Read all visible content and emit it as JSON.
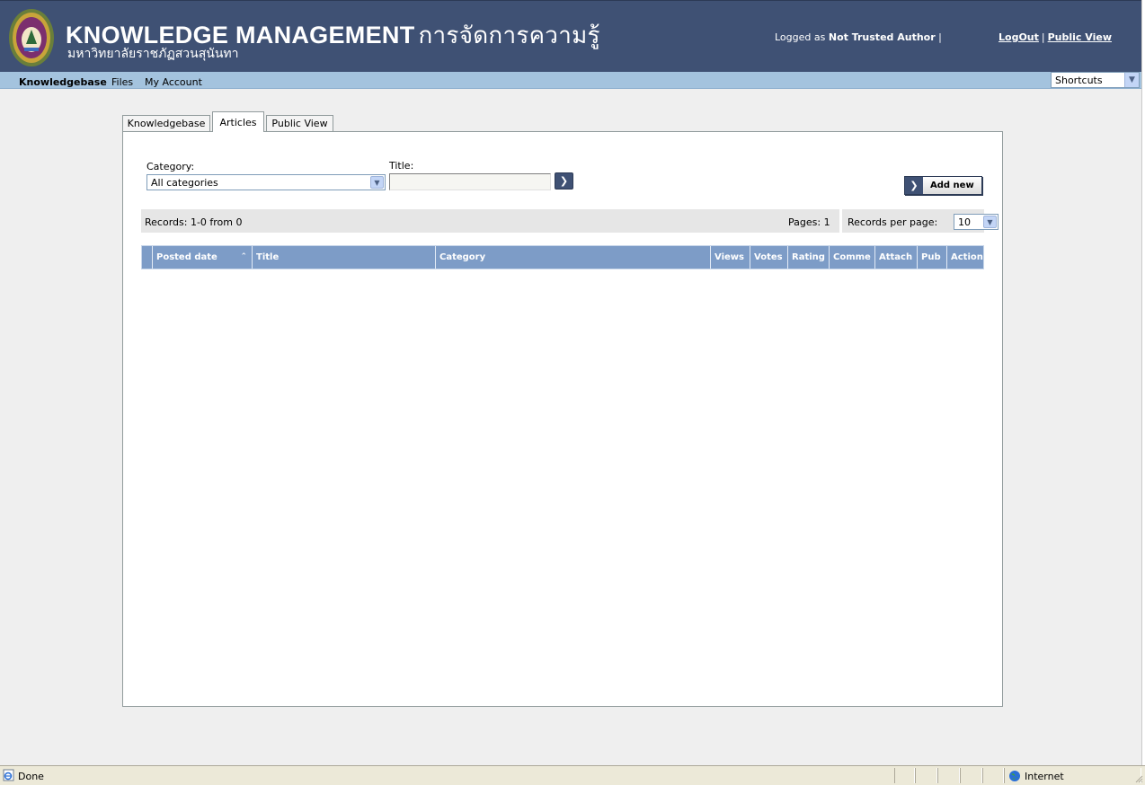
{
  "header": {
    "title": "KNOWLEDGE MANAGEMENT",
    "title_thai": "การจัดการความรู้",
    "subtitle": "มหาวิทยาลัยราชภัฏสวนสุนันทา",
    "logged_as_label": "Logged as",
    "user_name": "Not Trusted Author",
    "separator": "|",
    "logout_label": "LogOut",
    "public_view_label": "Public View"
  },
  "nav": {
    "items": [
      {
        "label": "Knowledgebase"
      },
      {
        "label": "Files"
      },
      {
        "label": "My Account"
      }
    ],
    "shortcuts_value": "Shortcuts"
  },
  "tabs": [
    {
      "label": "Knowledgebase"
    },
    {
      "label": "Articles"
    },
    {
      "label": "Public View"
    }
  ],
  "filters": {
    "category_label": "Category:",
    "category_value": "All categories",
    "title_label": "Title:",
    "title_value": "",
    "add_new_label": "Add new"
  },
  "records": {
    "summary": "Records: 1-0 from 0",
    "pages": "Pages: 1",
    "per_page_label": "Records per page:",
    "per_page_value": "10"
  },
  "table": {
    "columns": [
      {
        "label": "Posted date"
      },
      {
        "label": "Title"
      },
      {
        "label": "Category"
      },
      {
        "label": "Views"
      },
      {
        "label": "Votes"
      },
      {
        "label": "Rating"
      },
      {
        "label": "Comme"
      },
      {
        "label": "Attach"
      },
      {
        "label": "Pub"
      },
      {
        "label": "Action"
      }
    ],
    "rows": []
  },
  "statusbar": {
    "status": "Done",
    "zone": "Internet"
  },
  "colors": {
    "header_bg": "#3f5174",
    "nav_bg": "#a4c3de",
    "grid_header_bg": "#7d9cc7"
  }
}
